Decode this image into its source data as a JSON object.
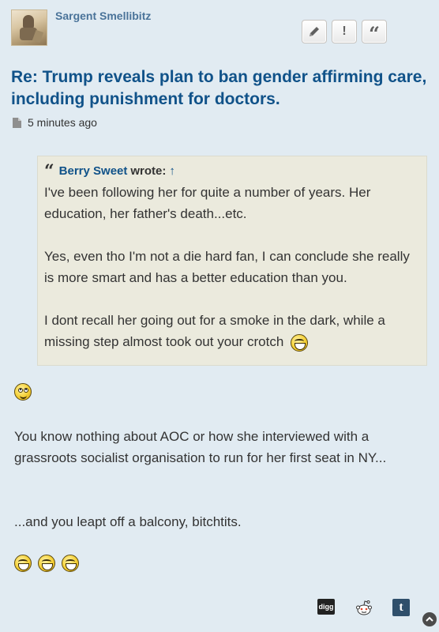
{
  "post": {
    "author": "Sargent Smellibitz",
    "title": "Re: Trump reveals plan to ban gender affirming care, including punishment for doctors.",
    "time": "5 minutes ago",
    "actions": [
      {
        "name": "edit-button",
        "icon": "pencil-icon"
      },
      {
        "name": "report-button",
        "icon": "exclamation-icon",
        "label": "!"
      },
      {
        "name": "quote-button",
        "icon": "quote-icon",
        "label": "“"
      }
    ]
  },
  "quote": {
    "author": "Berry Sweet",
    "wrote": "wrote:",
    "up_arrow": "↑",
    "paragraphs": [
      "I've been following her for quite a number of years. Her education, her father's death...etc.",
      "Yes, even tho I'm not a die hard fan, I can conclude she really is more smart and has a better education than you.",
      "I dont recall her going out for a smoke in the dark, while a missing step almost took out your crotch"
    ]
  },
  "body": {
    "paragraph1": "You know nothing about AOC or how she interviewed with a grassroots socialist organisation to run for her first seat in NY...",
    "paragraph2": "...and you leapt off a balcony, bitchtits."
  },
  "share": {
    "digg_label": "digg",
    "tumblr_label": "t",
    "icons": [
      "digg-icon",
      "reddit-icon",
      "tumblr-icon"
    ]
  },
  "colors": {
    "background": "#e1ebf2",
    "title": "#105289",
    "username": "#4a7399",
    "quote_bg": "#ebeadd"
  }
}
